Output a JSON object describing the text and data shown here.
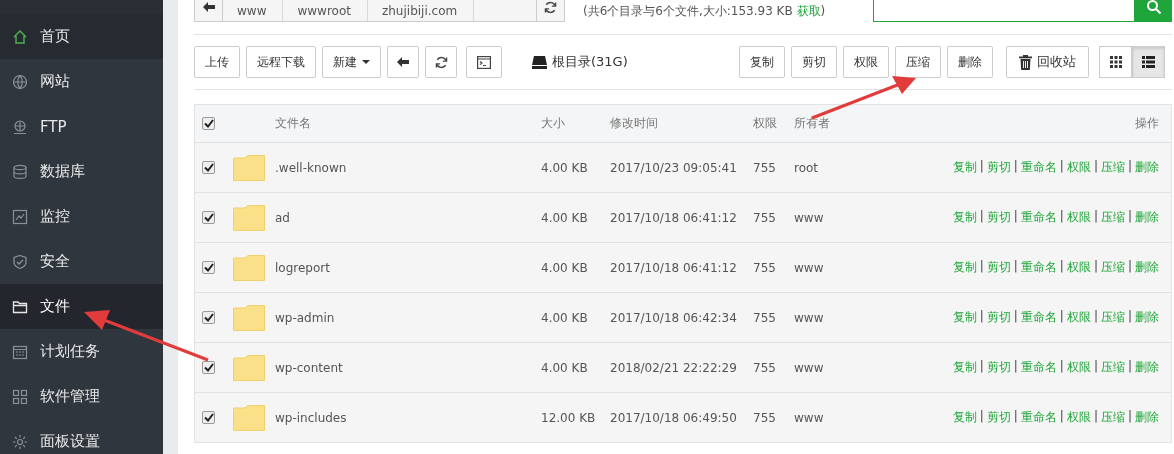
{
  "sidebar": {
    "items": [
      {
        "label": "首页",
        "selected": false,
        "hover": true
      },
      {
        "label": "网站",
        "selected": false,
        "hover": false
      },
      {
        "label": "FTP",
        "selected": false,
        "hover": false
      },
      {
        "label": "数据库",
        "selected": false,
        "hover": false
      },
      {
        "label": "监控",
        "selected": false,
        "hover": false
      },
      {
        "label": "安全",
        "selected": false,
        "hover": false
      },
      {
        "label": "文件",
        "selected": true,
        "hover": false
      },
      {
        "label": "计划任务",
        "selected": false,
        "hover": false
      },
      {
        "label": "软件管理",
        "selected": false,
        "hover": false
      },
      {
        "label": "面板设置",
        "selected": false,
        "hover": false
      }
    ]
  },
  "path_bar": {
    "crumbs": [
      "www",
      "wwwroot",
      "zhujibiji.com"
    ],
    "summary": "(共6个目录与6个文件,大小:153.93 KB ",
    "summary_link": "获取",
    "summary_end": ")"
  },
  "toolbar": {
    "left": [
      {
        "kind": "text",
        "label": "上传"
      },
      {
        "kind": "text",
        "label": "远程下载"
      },
      {
        "kind": "dropdown",
        "label": "新建"
      },
      {
        "kind": "back"
      },
      {
        "kind": "refresh"
      },
      {
        "kind": "terminal"
      }
    ],
    "disk": "根目录(31G)",
    "right": [
      {
        "kind": "text",
        "label": "复制"
      },
      {
        "kind": "text",
        "label": "剪切"
      },
      {
        "kind": "text",
        "label": "权限"
      },
      {
        "kind": "text",
        "label": "压缩"
      },
      {
        "kind": "text",
        "label": "删除"
      },
      {
        "kind": "trash",
        "label": "回收站"
      }
    ],
    "views": [
      {
        "kind": "grid",
        "selected": false
      },
      {
        "kind": "list",
        "selected": true
      }
    ]
  },
  "table": {
    "all_checked": true,
    "columns": [
      "文件名",
      "大小",
      "修改时间",
      "权限",
      "所有者",
      "操作"
    ],
    "separator": "|",
    "rows": [
      {
        "checked": true,
        "name": ".well-known",
        "size": "4.00 KB",
        "modified": "2017/10/23 09:05:41",
        "perm": "755",
        "owner": "root",
        "actions": [
          "复制",
          "剪切",
          "重命名",
          "权限",
          "压缩",
          "删除"
        ]
      },
      {
        "checked": true,
        "name": "ad",
        "size": "4.00 KB",
        "modified": "2017/10/18 06:41:12",
        "perm": "755",
        "owner": "www",
        "actions": [
          "复制",
          "剪切",
          "重命名",
          "权限",
          "压缩",
          "删除"
        ]
      },
      {
        "checked": true,
        "name": "logreport",
        "size": "4.00 KB",
        "modified": "2017/10/18 06:41:12",
        "perm": "755",
        "owner": "www",
        "actions": [
          "复制",
          "剪切",
          "重命名",
          "权限",
          "压缩",
          "删除"
        ]
      },
      {
        "checked": true,
        "name": "wp-admin",
        "size": "4.00 KB",
        "modified": "2017/10/18 06:42:34",
        "perm": "755",
        "owner": "www",
        "actions": [
          "复制",
          "剪切",
          "重命名",
          "权限",
          "压缩",
          "删除"
        ]
      },
      {
        "checked": true,
        "name": "wp-content",
        "size": "4.00 KB",
        "modified": "2018/02/21 22:22:29",
        "perm": "755",
        "owner": "www",
        "actions": [
          "复制",
          "剪切",
          "重命名",
          "权限",
          "压缩",
          "删除"
        ]
      },
      {
        "checked": true,
        "name": "wp-includes",
        "size": "12.00 KB",
        "modified": "2017/10/18 06:49:50",
        "perm": "755",
        "owner": "www",
        "actions": [
          "复制",
          "剪切",
          "重命名",
          "权限",
          "压缩",
          "删除"
        ]
      }
    ]
  }
}
